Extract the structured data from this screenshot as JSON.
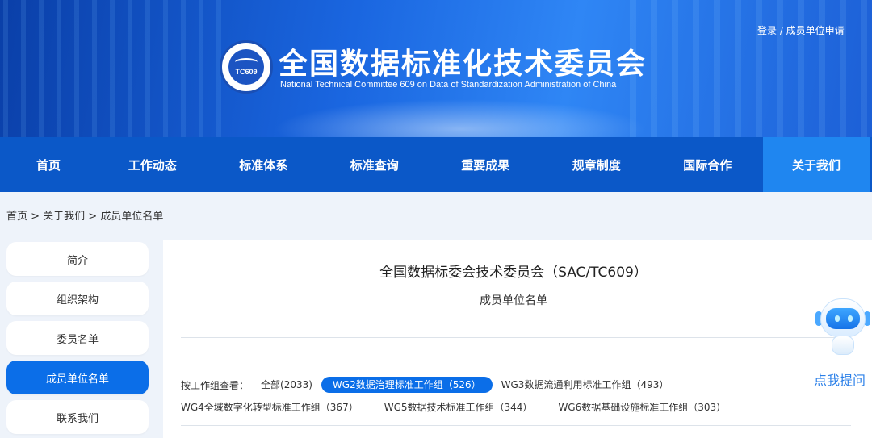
{
  "header": {
    "title": "全国数据标准化技术委员会",
    "subtitle": "National Technical Committee 609 on Data of Standardization Administration of China",
    "logo_text": "TC609",
    "top_links": "登录 / 成员单位申请"
  },
  "nav": {
    "items": [
      "首页",
      "工作动态",
      "标准体系",
      "标准查询",
      "重要成果",
      "规章制度",
      "国际合作",
      "关于我们"
    ],
    "active": "关于我们"
  },
  "breadcrumb": "首页 > 关于我们 > 成员单位名单",
  "sidebar": {
    "items": [
      "简介",
      "组织架构",
      "委员名单",
      "成员单位名单",
      "联系我们"
    ],
    "active": "成员单位名单"
  },
  "main": {
    "title": "全国数据标委会技术委员会（SAC/TC609）",
    "subtitle": "成员单位名单",
    "filter_label": "按工作组查看：",
    "filters_row1": [
      "全部(2033)",
      "WG2数据治理标准工作组（526）",
      "WG3数据流通利用标准工作组（493）"
    ],
    "filters_row2": [
      "WG4全域数字化转型标准工作组（367）",
      "WG5数据技术标准工作组（344）",
      "WG6数据基础设施标准工作组（303）"
    ],
    "active_filter": "WG2数据治理标准工作组（526）"
  },
  "assistant": {
    "label": "点我提问"
  },
  "colors": {
    "nav_bg": "#0b58c8",
    "nav_active": "#1f86f0",
    "accent": "#0b6ee8"
  }
}
